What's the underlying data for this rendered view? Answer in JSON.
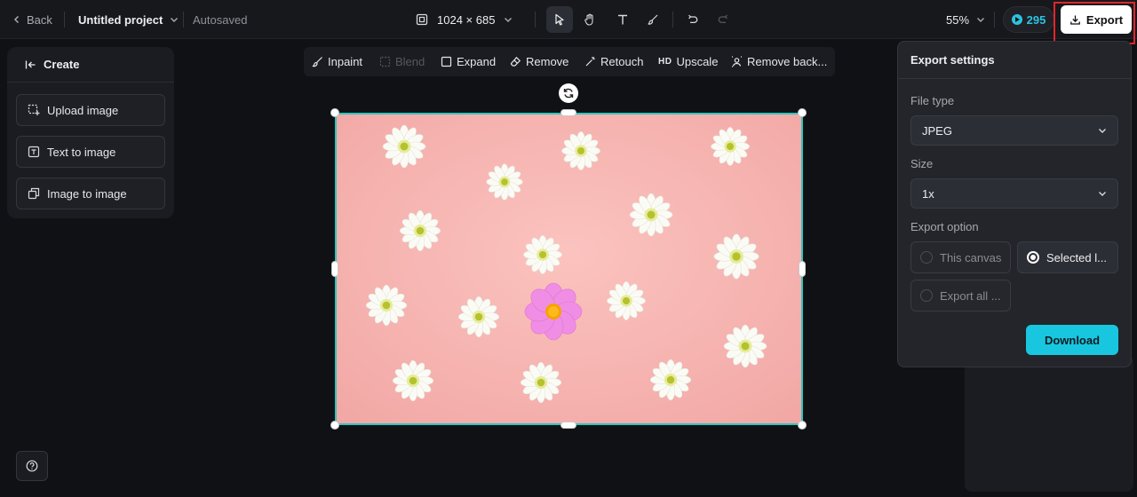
{
  "topbar": {
    "back_label": "Back",
    "project_name": "Untitled project",
    "save_status": "Autosaved",
    "canvas_size": "1024 × 685",
    "zoom": "55%",
    "credits": "295",
    "export_label": "Export"
  },
  "create_panel": {
    "title": "Create",
    "items": [
      {
        "label": "Upload image"
      },
      {
        "label": "Text to image"
      },
      {
        "label": "Image to image"
      }
    ]
  },
  "edit_toolbar": {
    "items": [
      {
        "label": "Inpaint",
        "icon": "brush-icon",
        "enabled": true
      },
      {
        "label": "Blend",
        "icon": "blend-icon",
        "enabled": false
      },
      {
        "label": "Expand",
        "icon": "expand-icon",
        "enabled": true
      },
      {
        "label": "Remove",
        "icon": "eraser-icon",
        "enabled": true
      },
      {
        "label": "Retouch",
        "icon": "magic-wand-icon",
        "enabled": true
      },
      {
        "label": "Upscale",
        "badge": "HD",
        "icon": "hd-icon",
        "enabled": true
      },
      {
        "label": "Remove back...",
        "icon": "remove-background-icon",
        "enabled": true
      }
    ]
  },
  "export_settings": {
    "title": "Export settings",
    "file_type_label": "File type",
    "file_type_value": "JPEG",
    "size_label": "Size",
    "size_value": "1x",
    "export_option_label": "Export option",
    "options": [
      {
        "label": "This canvas",
        "selected": false
      },
      {
        "label": "Selected l...",
        "selected": true
      },
      {
        "label": "Export all ...",
        "selected": false
      }
    ],
    "download_label": "Download"
  },
  "colors": {
    "accent": "#18c7df",
    "selection": "#2cc5c0",
    "canvas_bg": "#f6b4b0",
    "highlight": "#e0262b"
  }
}
